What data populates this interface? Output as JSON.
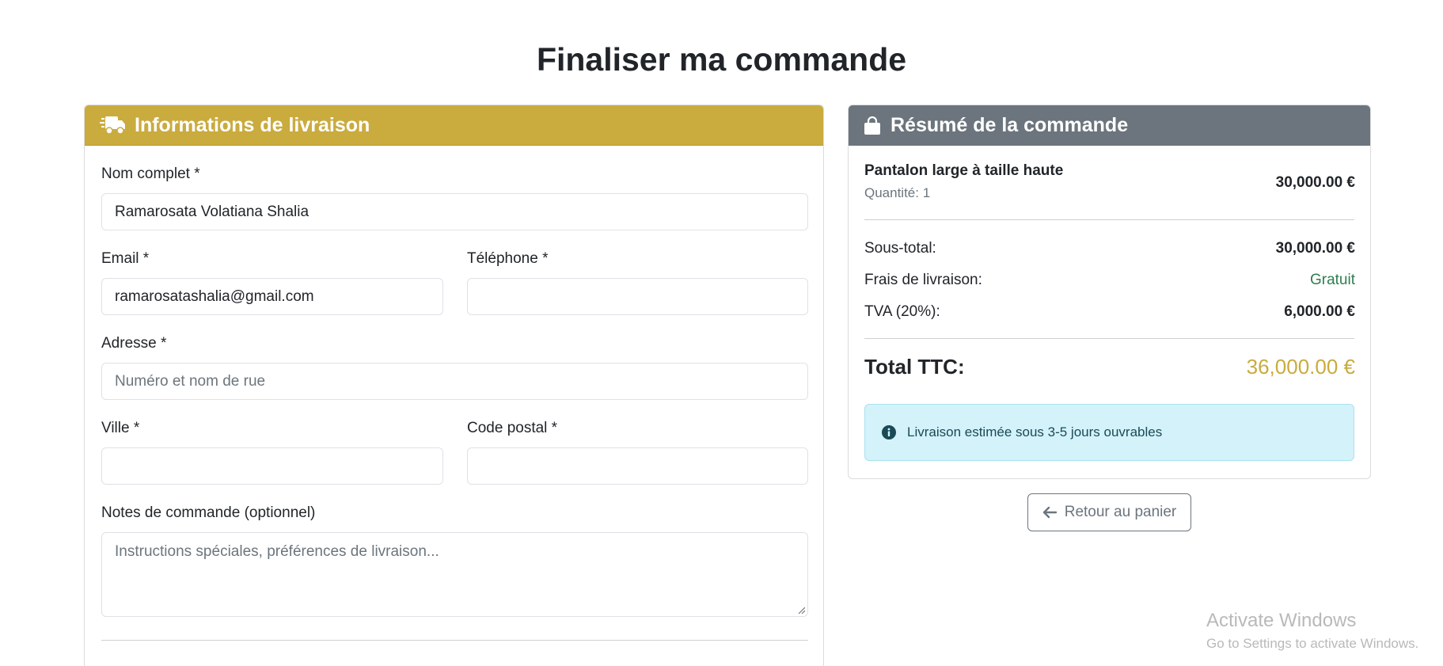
{
  "page": {
    "title": "Finaliser ma commande"
  },
  "shipping": {
    "header": "Informations de livraison",
    "full_name": {
      "label": "Nom complet *",
      "value": "Ramarosata Volatiana Shalia"
    },
    "email": {
      "label": "Email *",
      "value": "ramarosatashalia@gmail.com"
    },
    "phone": {
      "label": "Téléphone *",
      "value": ""
    },
    "address": {
      "label": "Adresse *",
      "placeholder": "Numéro et nom de rue"
    },
    "city": {
      "label": "Ville *",
      "value": ""
    },
    "postal_code": {
      "label": "Code postal *",
      "value": ""
    },
    "notes": {
      "label": "Notes de commande (optionnel)",
      "placeholder": "Instructions spéciales, préférences de livraison..."
    }
  },
  "summary": {
    "header": "Résumé de la commande",
    "item": {
      "name": "Pantalon large à taille haute",
      "quantity": "Quantité: 1",
      "price": "30,000.00 €"
    },
    "subtotal": {
      "label": "Sous-total:",
      "value": "30,000.00 €"
    },
    "shipping_fee": {
      "label": "Frais de livraison:",
      "value": "Gratuit"
    },
    "tax": {
      "label": "TVA (20%):",
      "value": "6,000.00 €"
    },
    "total": {
      "label": "Total TTC:",
      "value": "36,000.00 €"
    },
    "delivery_note": "Livraison estimée sous 3-5 jours ouvrables"
  },
  "actions": {
    "back_to_cart": "Retour au panier"
  },
  "watermark": {
    "title": "Activate Windows",
    "subtitle": "Go to Settings to activate Windows."
  },
  "colors": {
    "accent_gold": "#caab3e",
    "summary_header_gray": "#6c757d",
    "free_green": "#2e7d4f",
    "info_bg": "#d4f2fa"
  },
  "icons": {
    "shipping_header": "truck-fast-icon",
    "summary_header": "shopping-bag-icon",
    "alert": "info-circle-icon",
    "back": "arrow-left-icon"
  }
}
